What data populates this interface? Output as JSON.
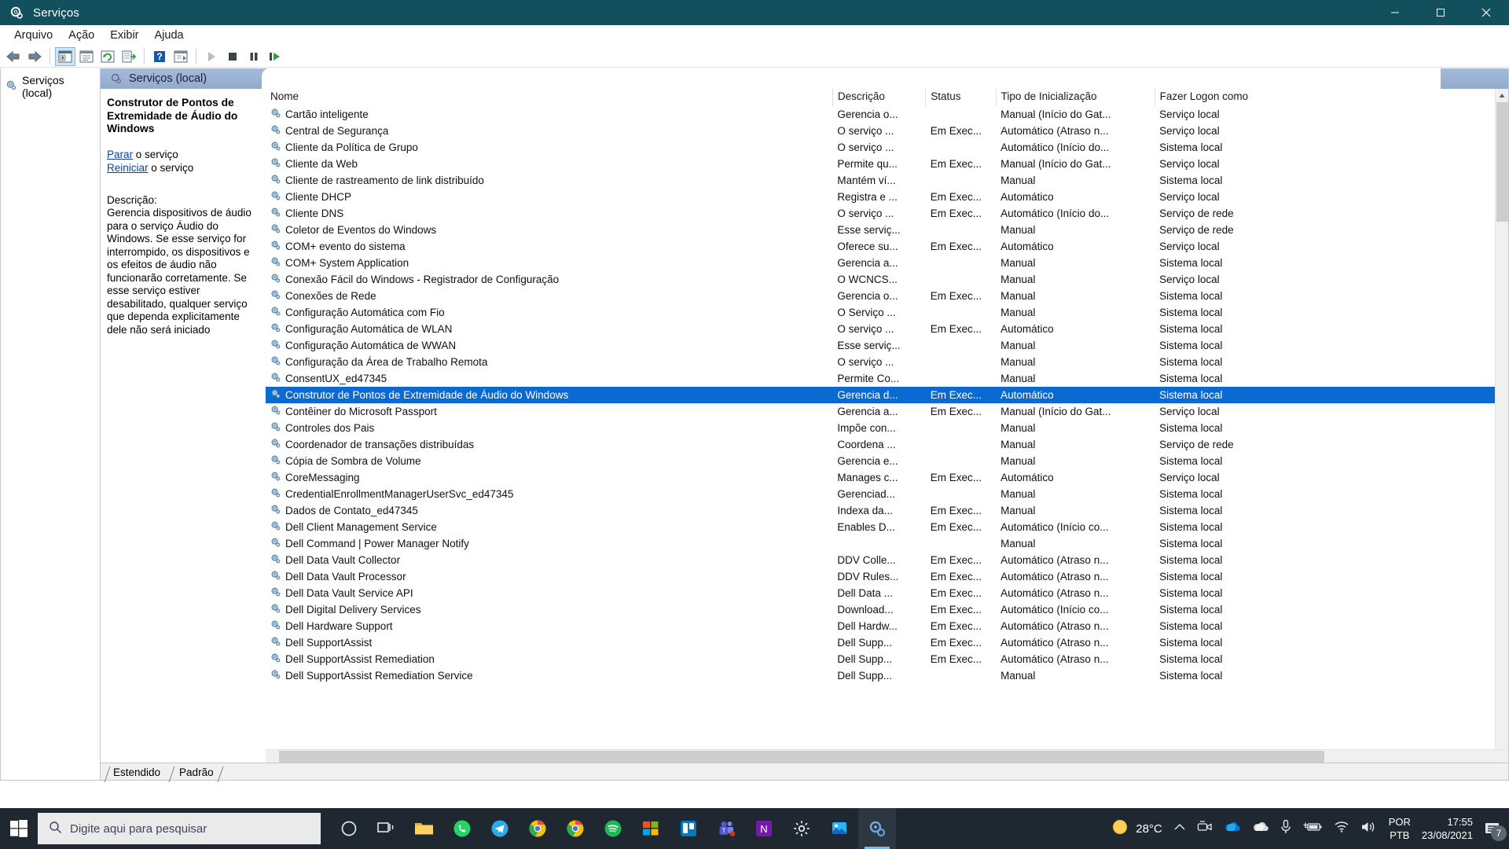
{
  "window": {
    "title": "Serviços",
    "app_icon": "services-gear-icon",
    "minimize_label": "—",
    "maximize_label": "▢",
    "close_label": "✕"
  },
  "menubar": {
    "items": [
      "Arquivo",
      "Ação",
      "Exibir",
      "Ajuda"
    ]
  },
  "toolbar": {
    "buttons": [
      {
        "name": "back-icon"
      },
      {
        "name": "forward-icon"
      },
      {
        "name": "show-hide-console-tree-icon"
      },
      {
        "name": "properties-icon"
      },
      {
        "name": "refresh-icon"
      },
      {
        "name": "export-list-icon"
      },
      {
        "name": "help-icon"
      },
      {
        "name": "new-window-icon"
      },
      {
        "name": "start-service-icon"
      },
      {
        "name": "stop-service-icon"
      },
      {
        "name": "pause-service-icon"
      },
      {
        "name": "restart-service-icon"
      }
    ]
  },
  "tree": {
    "root_label": "Serviços (local)",
    "root_icon": "services-gear-icon"
  },
  "pane": {
    "header_label": "Serviços (local)",
    "header_icon": "services-gear-icon"
  },
  "details": {
    "service_title": "Construtor de Pontos de Extremidade de Áudio do Windows",
    "stop_link": "Parar",
    "stop_suffix": " o serviço",
    "restart_link": "Reiniciar",
    "restart_suffix": " o serviço",
    "description_label": "Descrição:",
    "description_text": "Gerencia dispositivos de áudio para o serviço Áudio do Windows. Se esse serviço for interrompido, os dispositivos e os efeitos de áudio não funcionarão corretamente. Se esse serviço estiver desabilitado, qualquer serviço que dependa explicitamente dele não será iniciado"
  },
  "table": {
    "columns": [
      "Nome",
      "Descrição",
      "Status",
      "Tipo de Inicialização",
      "Fazer Logon como"
    ],
    "sort_indicator": "^",
    "selected_index": 17,
    "rows": [
      [
        "Cartão inteligente",
        "Gerencia o...",
        "",
        "Manual (Início do Gat...",
        "Serviço local"
      ],
      [
        "Central de Segurança",
        "O serviço ...",
        "Em Exec...",
        "Automático (Atraso n...",
        "Serviço local"
      ],
      [
        "Cliente da Política de Grupo",
        "O serviço ...",
        "",
        "Automático (Início do...",
        "Sistema local"
      ],
      [
        "Cliente da Web",
        "Permite qu...",
        "Em Exec...",
        "Manual (Início do Gat...",
        "Serviço local"
      ],
      [
        "Cliente de rastreamento de link distribuído",
        "Mantém ví...",
        "",
        "Manual",
        "Sistema local"
      ],
      [
        "Cliente DHCP",
        "Registra e ...",
        "Em Exec...",
        "Automático",
        "Serviço local"
      ],
      [
        "Cliente DNS",
        "O serviço ...",
        "Em Exec...",
        "Automático (Início do...",
        "Serviço de rede"
      ],
      [
        "Coletor de Eventos do Windows",
        "Esse serviç...",
        "",
        "Manual",
        "Serviço de rede"
      ],
      [
        "COM+ evento do sistema",
        "Oferece su...",
        "Em Exec...",
        "Automático",
        "Serviço local"
      ],
      [
        "COM+ System Application",
        "Gerencia a...",
        "",
        "Manual",
        "Sistema local"
      ],
      [
        "Conexão Fácil do Windows - Registrador de Configuração",
        "O WCNCS...",
        "",
        "Manual",
        "Serviço local"
      ],
      [
        "Conexões de Rede",
        "Gerencia o...",
        "Em Exec...",
        "Manual",
        "Sistema local"
      ],
      [
        "Configuração Automática com Fio",
        "O Serviço ...",
        "",
        "Manual",
        "Sistema local"
      ],
      [
        "Configuração Automática de WLAN",
        "O serviço ...",
        "Em Exec...",
        "Automático",
        "Sistema local"
      ],
      [
        "Configuração Automática de WWAN",
        "Esse serviç...",
        "",
        "Manual",
        "Sistema local"
      ],
      [
        "Configuração da Área de Trabalho Remota",
        "O serviço ...",
        "",
        "Manual",
        "Sistema local"
      ],
      [
        "ConsentUX_ed47345",
        "Permite Co...",
        "",
        "Manual",
        "Sistema local"
      ],
      [
        "Construtor de Pontos de Extremidade de Áudio do Windows",
        "Gerencia d...",
        "Em Exec...",
        "Automático",
        "Sistema local"
      ],
      [
        "Contêiner do Microsoft Passport",
        "Gerencia a...",
        "Em Exec...",
        "Manual (Início do Gat...",
        "Serviço local"
      ],
      [
        "Controles dos Pais",
        "Impõe con...",
        "",
        "Manual",
        "Sistema local"
      ],
      [
        "Coordenador de transações distribuídas",
        "Coordena ...",
        "",
        "Manual",
        "Serviço de rede"
      ],
      [
        "Cópia de Sombra de Volume",
        "Gerencia e...",
        "",
        "Manual",
        "Sistema local"
      ],
      [
        "CoreMessaging",
        "Manages c...",
        "Em Exec...",
        "Automático",
        "Serviço local"
      ],
      [
        "CredentialEnrollmentManagerUserSvc_ed47345",
        "Gerenciad...",
        "",
        "Manual",
        "Sistema local"
      ],
      [
        "Dados de Contato_ed47345",
        "Indexa da...",
        "Em Exec...",
        "Manual",
        "Sistema local"
      ],
      [
        "Dell Client Management Service",
        "Enables D...",
        "Em Exec...",
        "Automático (Início co...",
        "Sistema local"
      ],
      [
        "Dell Command | Power Manager Notify",
        "",
        "",
        "Manual",
        "Sistema local"
      ],
      [
        "Dell Data Vault Collector",
        "DDV Colle...",
        "Em Exec...",
        "Automático (Atraso n...",
        "Sistema local"
      ],
      [
        "Dell Data Vault Processor",
        "DDV Rules...",
        "Em Exec...",
        "Automático (Atraso n...",
        "Sistema local"
      ],
      [
        "Dell Data Vault Service API",
        "Dell Data ...",
        "Em Exec...",
        "Automático (Atraso n...",
        "Sistema local"
      ],
      [
        "Dell Digital Delivery Services",
        "Download...",
        "Em Exec...",
        "Automático (Início co...",
        "Sistema local"
      ],
      [
        "Dell Hardware Support",
        "Dell Hardw...",
        "Em Exec...",
        "Automático (Atraso n...",
        "Sistema local"
      ],
      [
        "Dell SupportAssist",
        "Dell Supp...",
        "Em Exec...",
        "Automático (Atraso n...",
        "Sistema local"
      ],
      [
        "Dell SupportAssist Remediation",
        "Dell Supp...",
        "Em Exec...",
        "Automático (Atraso n...",
        "Sistema local"
      ],
      [
        "Dell SupportAssist Remediation Service",
        "Dell Supp...",
        "",
        "Manual",
        "Sistema local"
      ]
    ]
  },
  "bottom_tabs": {
    "items": [
      "Estendido",
      "Padrão"
    ],
    "active": "Padrão"
  },
  "taskbar": {
    "start_icon": "windows-logo-icon",
    "search_placeholder": "Digite aqui para pesquisar",
    "search_icon": "search-icon",
    "apps": [
      {
        "name": "cortana-icon"
      },
      {
        "name": "task-view-icon"
      },
      {
        "name": "file-explorer-icon"
      },
      {
        "name": "whatsapp-icon"
      },
      {
        "name": "telegram-icon"
      },
      {
        "name": "chrome-icon"
      },
      {
        "name": "chrome-icon-2"
      },
      {
        "name": "spotify-icon"
      },
      {
        "name": "microsoft-store-icon"
      },
      {
        "name": "trello-icon"
      },
      {
        "name": "microsoft-teams-icon"
      },
      {
        "name": "onenote-icon"
      },
      {
        "name": "settings-icon"
      },
      {
        "name": "photos-icon"
      },
      {
        "name": "services-icon"
      }
    ],
    "weather_temp": "28°C",
    "weather_icon": "sun-icon",
    "tray_icons": [
      "chevron-up-icon",
      "screen-record-icon",
      "onedrive-icon",
      "onedrive-grey-icon",
      "microphone-icon",
      "plug-battery-icon",
      "wifi-icon",
      "volume-icon"
    ],
    "language_line1": "POR",
    "language_line2": "PTB",
    "time": "17:55",
    "date": "23/08/2021",
    "notification_count": "7",
    "notification_icon": "action-center-icon"
  },
  "colors": {
    "title_bar": "#12505e",
    "selection": "#0b6ad1",
    "pane_header": "#93aacd",
    "link": "#0645ad",
    "taskbar": "#1f2730"
  }
}
